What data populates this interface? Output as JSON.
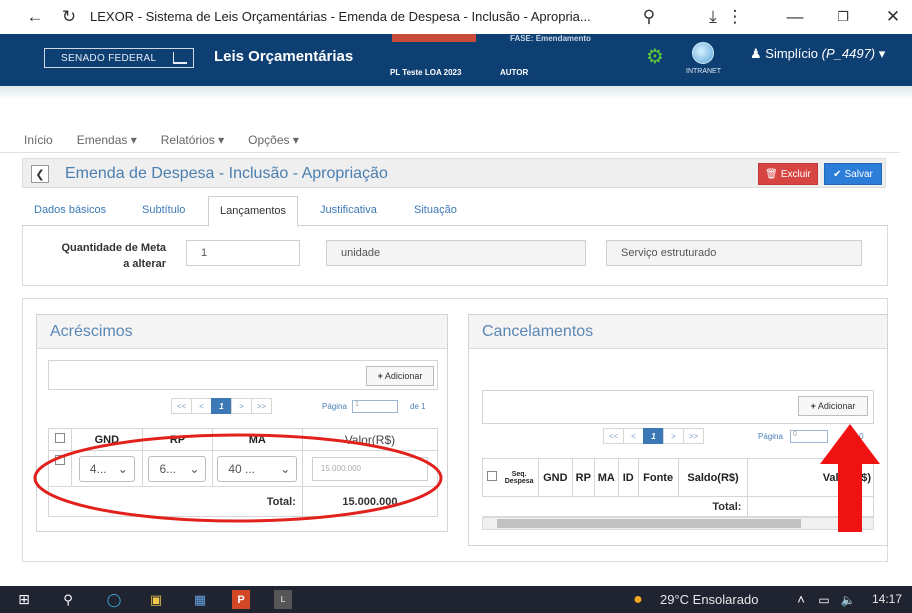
{
  "browser": {
    "title": "LEXOR - Sistema de Leis Orçamentárias - Emenda de Despesa - Inclusão - Apropria...",
    "back_icon": "arrow-left-icon",
    "reload_icon": "reload-icon",
    "zoom_icon": "zoom-icon",
    "download_icon": "download-icon",
    "menu_icon": "kebab-menu-icon"
  },
  "header": {
    "org": "SENADO FEDERAL",
    "app_title": "Leis Orçamentárias",
    "pl_label": "PL Teste LOA 2023",
    "autor_label": "AUTOR",
    "fase_label": "FASE: Emendamento",
    "intranet_label": "INTRANET",
    "user": "Simplício",
    "user_id": "(P_4497)",
    "brand_color": "#0e3f73"
  },
  "nav": {
    "items": [
      "Início",
      "Emendas ▾",
      "Relatórios ▾",
      "Opções ▾"
    ]
  },
  "page": {
    "title": "Emenda de Despesa - Inclusão - Apropriação",
    "excluir_label": "Excluir",
    "salvar_label": "Salvar"
  },
  "tabs": [
    "Dados básicos",
    "Subtítulo",
    "Lançamentos",
    "Justificativa",
    "Situação"
  ],
  "meta": {
    "label_line1": "Quantidade de Meta",
    "label_line2": "a alterar",
    "quantity": "1",
    "unit": "unidade",
    "product": "Serviço estruturado"
  },
  "acrescimos": {
    "title": "Acréscimos",
    "add_label": "Adicionar",
    "pager": [
      "<<",
      "<",
      "1",
      ">",
      ">>"
    ],
    "page_label": "Página",
    "page_value": "1",
    "page_of": "de 1",
    "columns": [
      "GND",
      "RP",
      "MA",
      "Valor(R$)"
    ],
    "row": {
      "gnd": "4...",
      "rp": "6...",
      "ma": "40 ...",
      "valor": "15.000.000"
    },
    "total_label": "Total:",
    "total_value": "15.000.000"
  },
  "cancelamentos": {
    "title": "Cancelamentos",
    "add_label": "Adicionar",
    "pager": [
      "<<",
      "<",
      "1",
      ">",
      ">>"
    ],
    "page_label": "Página",
    "page_value": "0",
    "page_of": "de 0",
    "columns": [
      "Seq. Despesa",
      "GND",
      "RP",
      "MA",
      "ID",
      "Fonte",
      "Saldo(R$)",
      "Valor(R$)"
    ],
    "total_label": "Total:"
  },
  "taskbar": {
    "weather": "29°C  Ensolarado",
    "time": "14:17"
  }
}
